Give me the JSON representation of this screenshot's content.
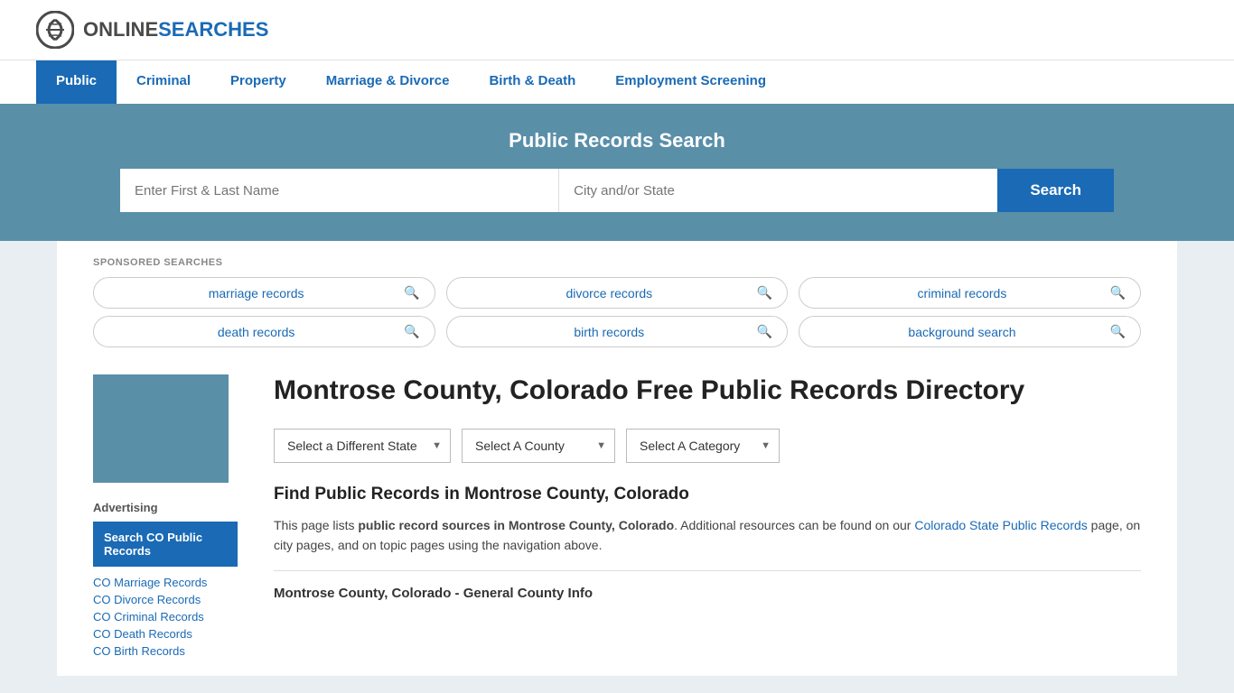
{
  "logo": {
    "online": "ONLINE",
    "searches": "SEARCHES"
  },
  "nav": {
    "items": [
      {
        "label": "Public",
        "active": true
      },
      {
        "label": "Criminal",
        "active": false
      },
      {
        "label": "Property",
        "active": false
      },
      {
        "label": "Marriage & Divorce",
        "active": false
      },
      {
        "label": "Birth & Death",
        "active": false
      },
      {
        "label": "Employment Screening",
        "active": false
      }
    ]
  },
  "search_banner": {
    "title": "Public Records Search",
    "name_placeholder": "Enter First & Last Name",
    "location_placeholder": "City and/or State",
    "button_label": "Search"
  },
  "sponsored": {
    "label": "SPONSORED SEARCHES",
    "pills": [
      [
        {
          "text": "marriage records"
        },
        {
          "text": "divorce records"
        },
        {
          "text": "criminal records"
        }
      ],
      [
        {
          "text": "death records"
        },
        {
          "text": "birth records"
        },
        {
          "text": "background search"
        }
      ]
    ]
  },
  "page": {
    "title": "Montrose County, Colorado Free Public Records Directory",
    "dropdowns": {
      "state": "Select a Different State",
      "county": "Select A County",
      "category": "Select A Category"
    },
    "find_title": "Find Public Records in Montrose County, Colorado",
    "find_text_1": "This page lists ",
    "find_text_bold": "public record sources in Montrose County, Colorado",
    "find_text_2": ". Additional resources can be found on our ",
    "find_link_text": "Colorado State Public Records",
    "find_text_3": " page, on city pages, and on topic pages using the navigation above.",
    "section_subtitle": "Montrose County, Colorado - General County Info"
  },
  "sidebar": {
    "ad_label": "Advertising",
    "ad_box_text": "Search CO Public Records",
    "links": [
      "CO Marriage Records",
      "CO Divorce Records",
      "CO Criminal Records",
      "CO Death Records",
      "CO Birth Records"
    ]
  }
}
